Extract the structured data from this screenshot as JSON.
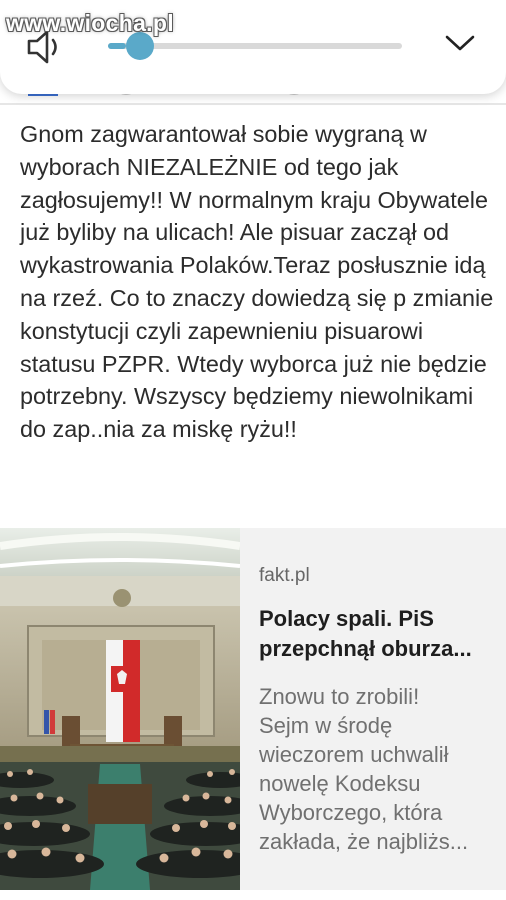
{
  "watermark": "www.wiocha.pl",
  "volume": {
    "level": 0.06,
    "speaker_icon": "speaker-icon",
    "collapse_icon": "chevron-down-icon",
    "accent": "#5aa9c9"
  },
  "post": {
    "text": "Gnom zagwarantował sobie wygraną w wyborach NIEZALEŻNIE od tego jak zagłosujemy!! W normalnym kraju Obywatele już byliby na ulicach! Ale pisuar zaczął od wykastrowania Polaków.Teraz posłusznie idą na rzeź. Co to znaczy dowiedzą się p zmianie konstytucji czyli zapewnieniu pisuarowi statusu PZPR. Wtedy wyborca już nie będzie potrzebny. Wszyscy będziemy niewolnikami do zap..nia za miskę ryżu!!"
  },
  "link_card": {
    "source": "fakt.pl",
    "title_lines": [
      "Polacy spali. PiS",
      "przepchnął oburza..."
    ],
    "description_lines": [
      "Znowu to zrobili!",
      "Sejm w środę",
      "wieczorem uchwalił",
      "nowelę Kodeksu",
      "Wyborczego, która",
      "zakłada, że najbliżs..."
    ]
  }
}
